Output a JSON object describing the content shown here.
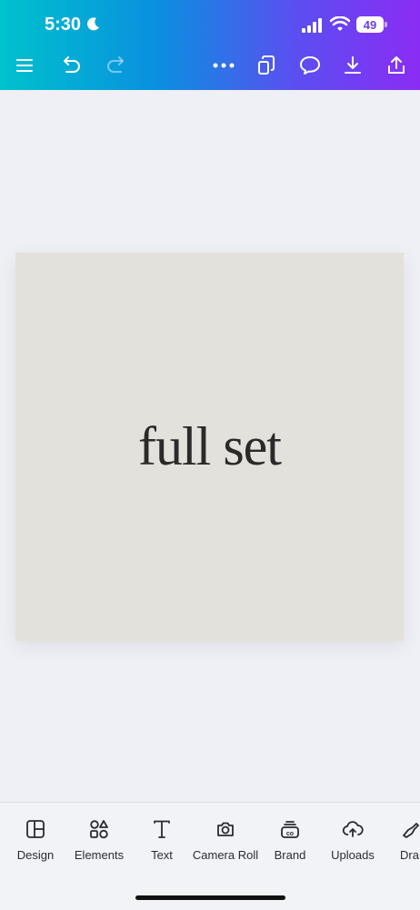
{
  "status_bar": {
    "time": "5:30",
    "battery": "49"
  },
  "toolbar": {
    "menu_icon": "menu-icon",
    "undo_icon": "undo-icon",
    "redo_icon": "redo-icon",
    "more_icon": "more-icon",
    "pages_icon": "pages-icon",
    "comment_icon": "comment-icon",
    "download_icon": "download-icon",
    "share_icon": "share-icon"
  },
  "design": {
    "text": "full set",
    "background_color": "#e3e1dc"
  },
  "bottom_tools": [
    {
      "label": "Design",
      "icon": "design-icon"
    },
    {
      "label": "Elements",
      "icon": "elements-icon"
    },
    {
      "label": "Text",
      "icon": "text-icon"
    },
    {
      "label": "Camera Roll",
      "icon": "camera-icon"
    },
    {
      "label": "Brand",
      "icon": "brand-icon"
    },
    {
      "label": "Uploads",
      "icon": "uploads-icon"
    },
    {
      "label": "Dra",
      "icon": "draw-icon"
    }
  ],
  "colors": {
    "header_start": "#00c2cc",
    "header_end": "#8b2cf5",
    "stage": "#eff0f5"
  }
}
